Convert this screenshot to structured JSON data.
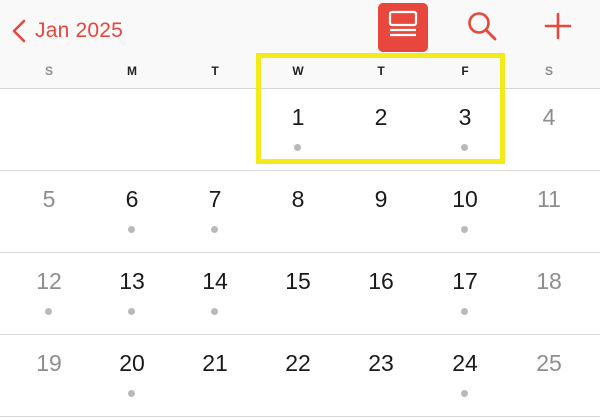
{
  "header": {
    "back_label": "Jan 2025",
    "accent_color": "#e8473d",
    "icons": [
      "chevron-left-icon",
      "list-view-icon",
      "search-icon",
      "plus-icon"
    ]
  },
  "weekdays": [
    "S",
    "M",
    "T",
    "W",
    "T",
    "F",
    "S"
  ],
  "weeks": [
    [
      null,
      null,
      null,
      "1",
      "2",
      "3",
      "4"
    ],
    [
      "5",
      "6",
      "7",
      "8",
      "9",
      "10",
      "11"
    ],
    [
      "12",
      "13",
      "14",
      "15",
      "16",
      "17",
      "18"
    ],
    [
      "19",
      "20",
      "21",
      "22",
      "23",
      "24",
      "25"
    ]
  ],
  "event_days": [
    "1",
    "3",
    "6",
    "7",
    "10",
    "12",
    "13",
    "14",
    "17",
    "20",
    "24"
  ],
  "highlight": {
    "color": "#f4ea1a",
    "dates": [
      "1",
      "2",
      "3"
    ]
  }
}
